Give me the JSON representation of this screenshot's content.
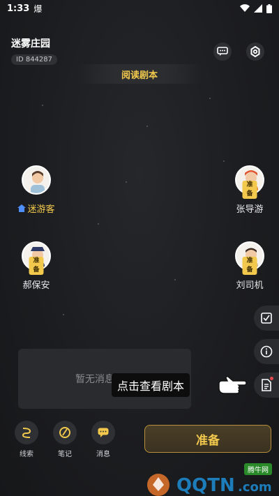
{
  "status_bar": {
    "time": "1:33",
    "notification": "爆"
  },
  "header": {
    "room_title": "迷雾庄园",
    "room_id": "ID 844287",
    "read_script_label": "阅读剧本"
  },
  "players": [
    {
      "name": "迷游客",
      "ready_badge": "",
      "is_host": true
    },
    {
      "name": "张导游",
      "ready_badge": "准备",
      "is_host": false
    },
    {
      "name": "郝保安",
      "ready_badge": "准备",
      "is_host": false
    },
    {
      "name": "刘司机",
      "ready_badge": "准备",
      "is_host": false
    }
  ],
  "messages": {
    "empty_text": "暂无消息通知",
    "tooltip": "点击查看剧本"
  },
  "bottom_bar": {
    "tools": [
      {
        "label": "线索",
        "icon": "clue-icon"
      },
      {
        "label": "笔记",
        "icon": "notes-icon"
      },
      {
        "label": "消息",
        "icon": "message-icon"
      }
    ],
    "ready_label": "准备"
  },
  "watermark": {
    "logo": "QQTN.com",
    "tag": "腾牛网"
  },
  "colors": {
    "accent": "#f2c94c",
    "background": "#1a1b1e",
    "alert": "#e5484d"
  }
}
